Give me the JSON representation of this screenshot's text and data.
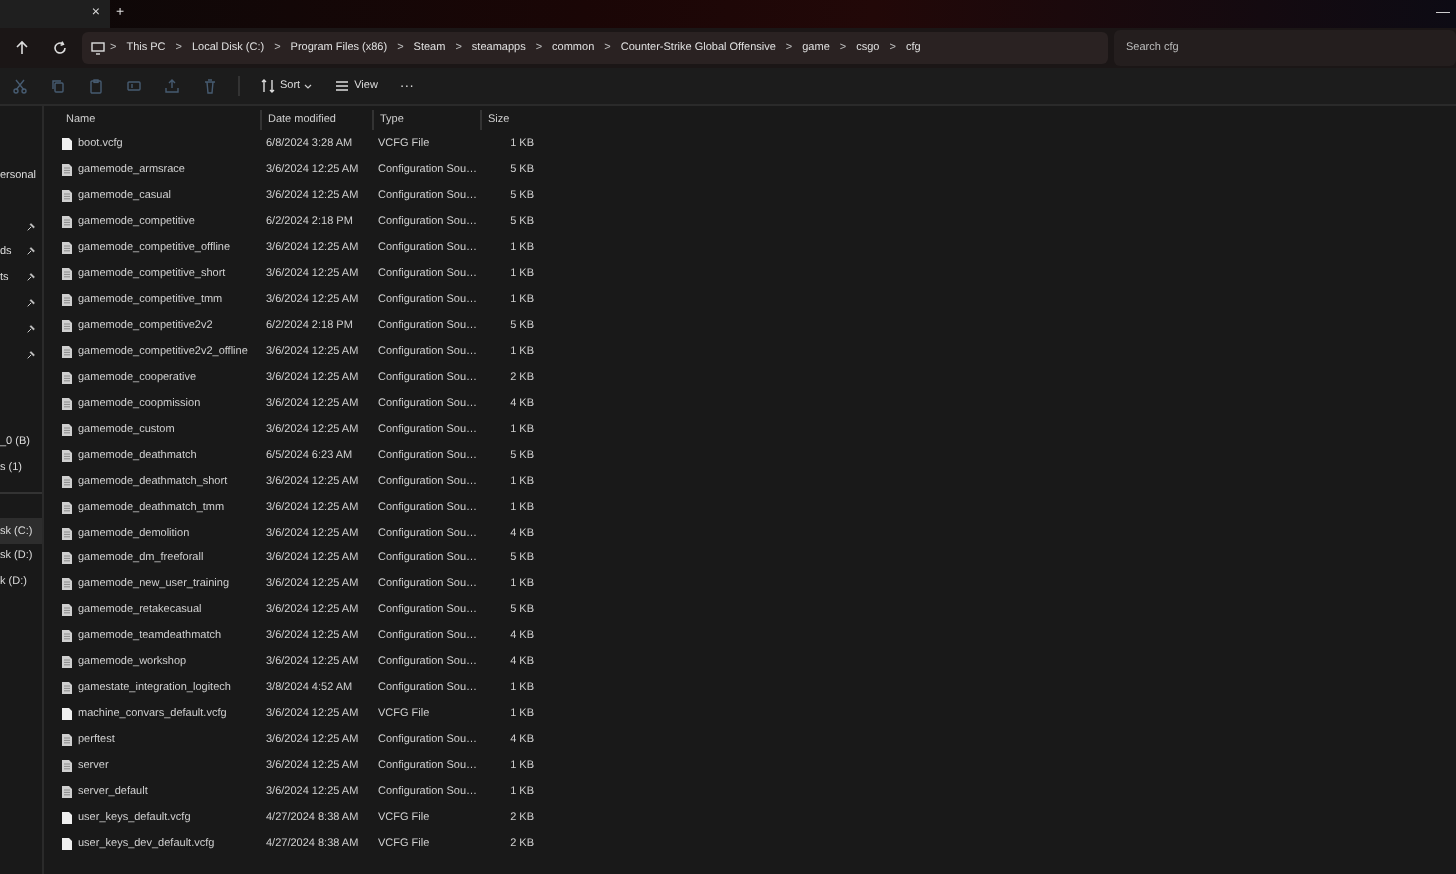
{
  "window": {
    "tab_close": "×",
    "new_tab": "+",
    "minimize": "—"
  },
  "address_bar": {
    "breadcrumbs": [
      "This PC",
      "Local Disk (C:)",
      "Program Files (x86)",
      "Steam",
      "steamapps",
      "common",
      "Counter-Strike Global Offensive",
      "game",
      "csgo",
      "cfg"
    ],
    "separator": ">"
  },
  "search": {
    "placeholder": "Search cfg"
  },
  "toolbar": {
    "buttons": [
      {
        "kind": "cut",
        "disabled": true
      },
      {
        "kind": "copy",
        "disabled": true
      },
      {
        "kind": "paste",
        "disabled": true
      },
      {
        "kind": "rename",
        "disabled": true
      },
      {
        "kind": "share",
        "disabled": true
      },
      {
        "kind": "delete",
        "disabled": true
      }
    ],
    "sort": "Sort",
    "view": "View",
    "more": "···"
  },
  "sidebar": {
    "groups": [
      [
        {
          "label": "ersonal",
          "pinned": false,
          "selected": false
        }
      ],
      [
        {
          "pinned": true,
          "selected": false
        },
        {
          "label": "ds",
          "pinned": true,
          "selected": false
        },
        {
          "label": "ts",
          "pinned": true,
          "selected": false
        },
        {
          "pinned": true,
          "selected": false
        },
        {
          "pinned": true,
          "selected": false
        },
        {
          "pinned": true,
          "selected": false
        }
      ],
      [
        {
          "label": "_0 (B)",
          "pinned": false,
          "selected": false
        },
        {
          "label": "s (1)",
          "pinned": false,
          "selected": false
        }
      ],
      [
        {
          "label": "sk (C:)",
          "pinned": false,
          "selected": true
        },
        {
          "label": "sk (D:)",
          "pinned": false,
          "selected": false
        },
        {
          "label": "k (D:)",
          "pinned": false,
          "selected": false
        }
      ]
    ]
  },
  "table": {
    "columns": [
      "Name",
      "Date modified",
      "Type",
      "Size"
    ],
    "rows": [
      {
        "kind": "vcfg",
        "name": "boot.vcfg",
        "date": "6/8/2024 3:28 AM",
        "type": "VCFG File",
        "size": "1 KB"
      },
      {
        "kind": "config",
        "name": "gamemode_armsrace",
        "date": "3/6/2024 12:25 AM",
        "type": "Configuration Sou…",
        "size": "5 KB"
      },
      {
        "kind": "config",
        "name": "gamemode_casual",
        "date": "3/6/2024 12:25 AM",
        "type": "Configuration Sou…",
        "size": "5 KB"
      },
      {
        "kind": "config",
        "name": "gamemode_competitive",
        "date": "6/2/2024 2:18 PM",
        "type": "Configuration Sou…",
        "size": "5 KB"
      },
      {
        "kind": "config",
        "name": "gamemode_competitive_offline",
        "date": "3/6/2024 12:25 AM",
        "type": "Configuration Sou…",
        "size": "1 KB"
      },
      {
        "kind": "config",
        "name": "gamemode_competitive_short",
        "date": "3/6/2024 12:25 AM",
        "type": "Configuration Sou…",
        "size": "1 KB"
      },
      {
        "kind": "config",
        "name": "gamemode_competitive_tmm",
        "date": "3/6/2024 12:25 AM",
        "type": "Configuration Sou…",
        "size": "1 KB"
      },
      {
        "kind": "config",
        "name": "gamemode_competitive2v2",
        "date": "6/2/2024 2:18 PM",
        "type": "Configuration Sou…",
        "size": "5 KB"
      },
      {
        "kind": "config",
        "name": "gamemode_competitive2v2_offline",
        "date": "3/6/2024 12:25 AM",
        "type": "Configuration Sou…",
        "size": "1 KB"
      },
      {
        "kind": "config",
        "name": "gamemode_cooperative",
        "date": "3/6/2024 12:25 AM",
        "type": "Configuration Sou…",
        "size": "2 KB"
      },
      {
        "kind": "config",
        "name": "gamemode_coopmission",
        "date": "3/6/2024 12:25 AM",
        "type": "Configuration Sou…",
        "size": "4 KB"
      },
      {
        "kind": "config",
        "name": "gamemode_custom",
        "date": "3/6/2024 12:25 AM",
        "type": "Configuration Sou…",
        "size": "1 KB"
      },
      {
        "kind": "config",
        "name": "gamemode_deathmatch",
        "date": "6/5/2024 6:23 AM",
        "type": "Configuration Sou…",
        "size": "5 KB"
      },
      {
        "kind": "config",
        "name": "gamemode_deathmatch_short",
        "date": "3/6/2024 12:25 AM",
        "type": "Configuration Sou…",
        "size": "1 KB"
      },
      {
        "kind": "config",
        "name": "gamemode_deathmatch_tmm",
        "date": "3/6/2024 12:25 AM",
        "type": "Configuration Sou…",
        "size": "1 KB"
      },
      {
        "kind": "config",
        "name": "gamemode_demolition",
        "date": "3/6/2024 12:25 AM",
        "type": "Configuration Sou…",
        "size": "4 KB"
      },
      {
        "kind": "config",
        "name": "gamemode_dm_freeforall",
        "date": "3/6/2024 12:25 AM",
        "type": "Configuration Sou…",
        "size": "5 KB"
      },
      {
        "kind": "config",
        "name": "gamemode_new_user_training",
        "date": "3/6/2024 12:25 AM",
        "type": "Configuration Sou…",
        "size": "1 KB"
      },
      {
        "kind": "config",
        "name": "gamemode_retakecasual",
        "date": "3/6/2024 12:25 AM",
        "type": "Configuration Sou…",
        "size": "5 KB"
      },
      {
        "kind": "config",
        "name": "gamemode_teamdeathmatch",
        "date": "3/6/2024 12:25 AM",
        "type": "Configuration Sou…",
        "size": "4 KB"
      },
      {
        "kind": "config",
        "name": "gamemode_workshop",
        "date": "3/6/2024 12:25 AM",
        "type": "Configuration Sou…",
        "size": "4 KB"
      },
      {
        "kind": "config",
        "name": "gamestate_integration_logitech",
        "date": "3/8/2024 4:52 AM",
        "type": "Configuration Sou…",
        "size": "1 KB"
      },
      {
        "kind": "vcfg",
        "name": "machine_convars_default.vcfg",
        "date": "3/6/2024 12:25 AM",
        "type": "VCFG File",
        "size": "1 KB"
      },
      {
        "kind": "config",
        "name": "perftest",
        "date": "3/6/2024 12:25 AM",
        "type": "Configuration Sou…",
        "size": "4 KB"
      },
      {
        "kind": "config",
        "name": "server",
        "date": "3/6/2024 12:25 AM",
        "type": "Configuration Sou…",
        "size": "1 KB"
      },
      {
        "kind": "config",
        "name": "server_default",
        "date": "3/6/2024 12:25 AM",
        "type": "Configuration Sou…",
        "size": "1 KB"
      },
      {
        "kind": "vcfg",
        "name": "user_keys_default.vcfg",
        "date": "4/27/2024 8:38 AM",
        "type": "VCFG File",
        "size": "2 KB"
      },
      {
        "kind": "vcfg",
        "name": "user_keys_dev_default.vcfg",
        "date": "4/27/2024 8:38 AM",
        "type": "VCFG File",
        "size": "2 KB"
      }
    ]
  }
}
